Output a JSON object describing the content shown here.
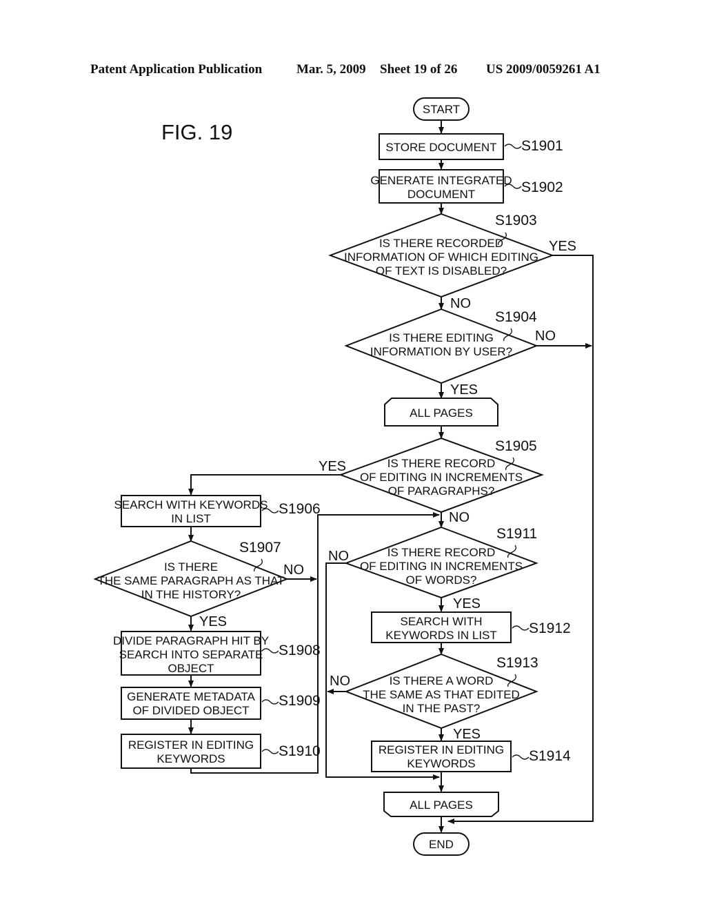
{
  "header": {
    "publication": "Patent Application Publication",
    "date": "Mar. 5, 2009",
    "sheet": "Sheet 19 of 26",
    "number": "US 2009/0059261 A1"
  },
  "figure_label": "FIG. 19",
  "nodes": {
    "start": {
      "lines": [
        "START"
      ]
    },
    "s1901": {
      "step": "S1901",
      "lines": [
        "STORE DOCUMENT"
      ]
    },
    "s1902": {
      "step": "S1902",
      "lines": [
        "GENERATE INTEGRATED",
        "DOCUMENT"
      ]
    },
    "s1903": {
      "step": "S1903",
      "lines": [
        "IS THERE RECORDED",
        "INFORMATION OF WHICH EDITING",
        "OF TEXT IS DISABLED?"
      ]
    },
    "s1904": {
      "step": "S1904",
      "lines": [
        "IS THERE EDITING",
        "INFORMATION BY USER?"
      ]
    },
    "loop_start": {
      "lines": [
        "ALL PAGES"
      ]
    },
    "s1905": {
      "step": "S1905",
      "lines": [
        "IS THERE RECORD",
        "OF EDITING IN INCREMENTS",
        "OF PARAGRAPHS?"
      ]
    },
    "s1906": {
      "step": "S1906",
      "lines": [
        "SEARCH WITH KEYWORDS",
        "IN LIST"
      ]
    },
    "s1907": {
      "step": "S1907",
      "lines": [
        "IS THERE",
        "THE SAME PARAGRAPH AS THAT",
        "IN THE HISTORY?"
      ]
    },
    "s1908": {
      "step": "S1908",
      "lines": [
        "DIVIDE PARAGRAPH HIT BY",
        "SEARCH INTO SEPARATE",
        "OBJECT"
      ]
    },
    "s1909": {
      "step": "S1909",
      "lines": [
        "GENERATE METADATA",
        "OF DIVIDED OBJECT"
      ]
    },
    "s1910": {
      "step": "S1910",
      "lines": [
        "REGISTER IN EDITING",
        "KEYWORDS"
      ]
    },
    "s1911": {
      "step": "S1911",
      "lines": [
        "IS THERE RECORD",
        "OF EDITING IN INCREMENTS",
        "OF WORDS?"
      ]
    },
    "s1912": {
      "step": "S1912",
      "lines": [
        "SEARCH WITH",
        "KEYWORDS IN LIST"
      ]
    },
    "s1913": {
      "step": "S1913",
      "lines": [
        "IS THERE A WORD",
        "THE SAME AS THAT EDITED",
        "IN THE PAST?"
      ]
    },
    "s1914": {
      "step": "S1914",
      "lines": [
        "REGISTER IN EDITING",
        "KEYWORDS"
      ]
    },
    "loop_end": {
      "lines": [
        "ALL PAGES"
      ]
    },
    "end": {
      "lines": [
        "END"
      ]
    }
  },
  "branch_labels": {
    "s1903_yes": "YES",
    "s1903_no": "NO",
    "s1904_yes": "YES",
    "s1904_no": "NO",
    "s1905_yes": "YES",
    "s1905_no": "NO",
    "s1907_yes": "YES",
    "s1907_no": "NO",
    "s1911_yes": "YES",
    "s1911_no": "NO",
    "s1913_yes": "YES",
    "s1913_no": "NO"
  }
}
